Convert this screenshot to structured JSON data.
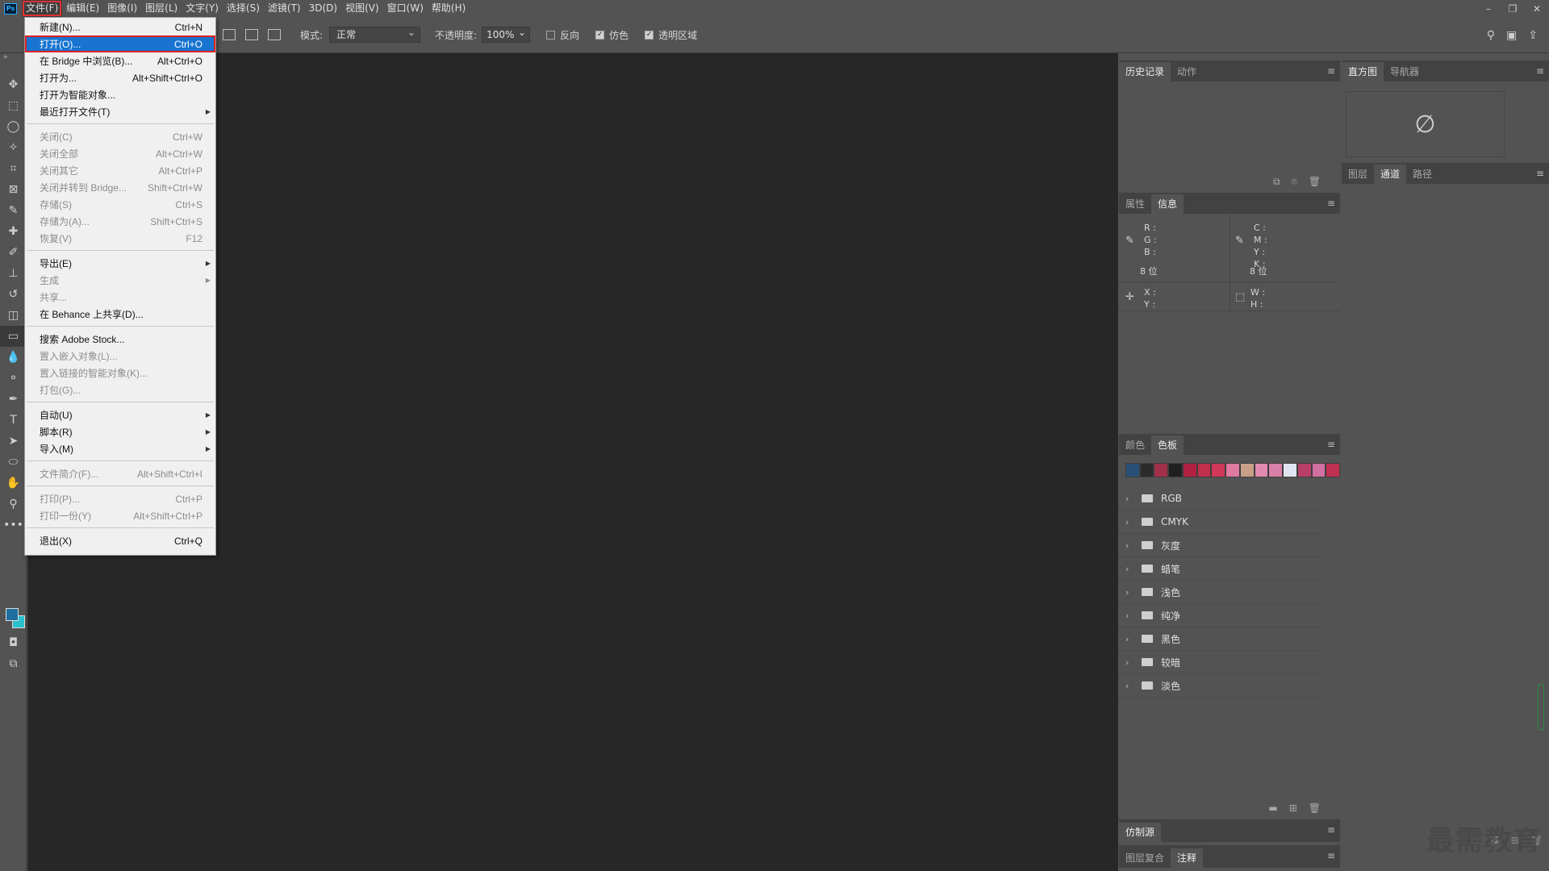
{
  "app": {
    "logo": "Ps"
  },
  "menubar": {
    "items": [
      "文件(F)",
      "编辑(E)",
      "图像(I)",
      "图层(L)",
      "文字(Y)",
      "选择(S)",
      "滤镜(T)",
      "3D(D)",
      "视图(V)",
      "窗口(W)",
      "帮助(H)"
    ]
  },
  "window_controls": {
    "minimize": "–",
    "restore": "❐",
    "close": "✕"
  },
  "options": {
    "mode_label": "模式:",
    "mode_value": "正常",
    "opacity_label": "不透明度:",
    "opacity_value": "100%",
    "reverse_label": "反向",
    "dither_label": "仿色",
    "transparency_label": "透明区域",
    "reverse_checked": false,
    "dither_checked": true,
    "transparency_checked": true
  },
  "file_menu": {
    "new": {
      "label": "新建(N)...",
      "shortcut": "Ctrl+N"
    },
    "open": {
      "label": "打开(O)...",
      "shortcut": "Ctrl+O"
    },
    "bridge": {
      "label": "在 Bridge 中浏览(B)...",
      "shortcut": "Alt+Ctrl+O"
    },
    "open_as": {
      "label": "打开为...",
      "shortcut": "Alt+Shift+Ctrl+O"
    },
    "open_smart": {
      "label": "打开为智能对象..."
    },
    "recent": {
      "label": "最近打开文件(T)"
    },
    "close": {
      "label": "关闭(C)",
      "shortcut": "Ctrl+W"
    },
    "close_all": {
      "label": "关闭全部",
      "shortcut": "Alt+Ctrl+W"
    },
    "close_others": {
      "label": "关闭其它",
      "shortcut": "Alt+Ctrl+P"
    },
    "close_bridge": {
      "label": "关闭并转到 Bridge...",
      "shortcut": "Shift+Ctrl+W"
    },
    "save": {
      "label": "存储(S)",
      "shortcut": "Ctrl+S"
    },
    "save_as": {
      "label": "存储为(A)...",
      "shortcut": "Shift+Ctrl+S"
    },
    "revert": {
      "label": "恢复(V)",
      "shortcut": "F12"
    },
    "export": {
      "label": "导出(E)"
    },
    "generate": {
      "label": "生成"
    },
    "share": {
      "label": "共享..."
    },
    "behance": {
      "label": "在 Behance 上共享(D)..."
    },
    "stock": {
      "label": "搜索 Adobe Stock..."
    },
    "place_embed": {
      "label": "置入嵌入对象(L)..."
    },
    "place_linked": {
      "label": "置入链接的智能对象(K)..."
    },
    "package": {
      "label": "打包(G)..."
    },
    "automate": {
      "label": "自动(U)"
    },
    "scripts": {
      "label": "脚本(R)"
    },
    "import": {
      "label": "导入(M)"
    },
    "file_info": {
      "label": "文件简介(F)...",
      "shortcut": "Alt+Shift+Ctrl+I"
    },
    "print": {
      "label": "打印(P)...",
      "shortcut": "Ctrl+P"
    },
    "print_one": {
      "label": "打印一份(Y)",
      "shortcut": "Alt+Shift+Ctrl+P"
    },
    "exit": {
      "label": "退出(X)",
      "shortcut": "Ctrl+Q"
    }
  },
  "panels": {
    "history": {
      "tabs": [
        "历史记录",
        "动作"
      ]
    },
    "histogram": {
      "tabs": [
        "直方图",
        "导航器"
      ],
      "empty_icon": "∅"
    },
    "layers": {
      "tabs": [
        "图层",
        "通道",
        "路径"
      ]
    },
    "info": {
      "tabs": [
        "属性",
        "信息"
      ],
      "rgb_labels": "R :\nG :\nB :",
      "cmyk_labels": "C :\nM :\nY :\nK :",
      "bits_left": "8 位",
      "bits_right": "8 位",
      "xy_labels": "X :\nY :",
      "wh_labels": "W :\nH :"
    },
    "swatches": {
      "tabs": [
        "颜色",
        "色板"
      ],
      "colors": [
        "#2a4f77",
        "#2b2b2b",
        "#a03048",
        "#1f1f1f",
        "#b02040",
        "#c0304a",
        "#d03858",
        "#e07aa0",
        "#c8a088",
        "#e28ab0",
        "#d880a8",
        "#e0e4f0",
        "#b84068",
        "#d070a0",
        "#c03050"
      ],
      "groups": [
        "RGB",
        "CMYK",
        "灰度",
        "蜡笔",
        "浅色",
        "纯净",
        "黑色",
        "较暗",
        "淡色"
      ]
    },
    "clone": {
      "tabs": [
        "仿制源"
      ]
    },
    "notes": {
      "tabs": [
        "图层复合",
        "注释"
      ]
    }
  },
  "watermark": "最需教育"
}
